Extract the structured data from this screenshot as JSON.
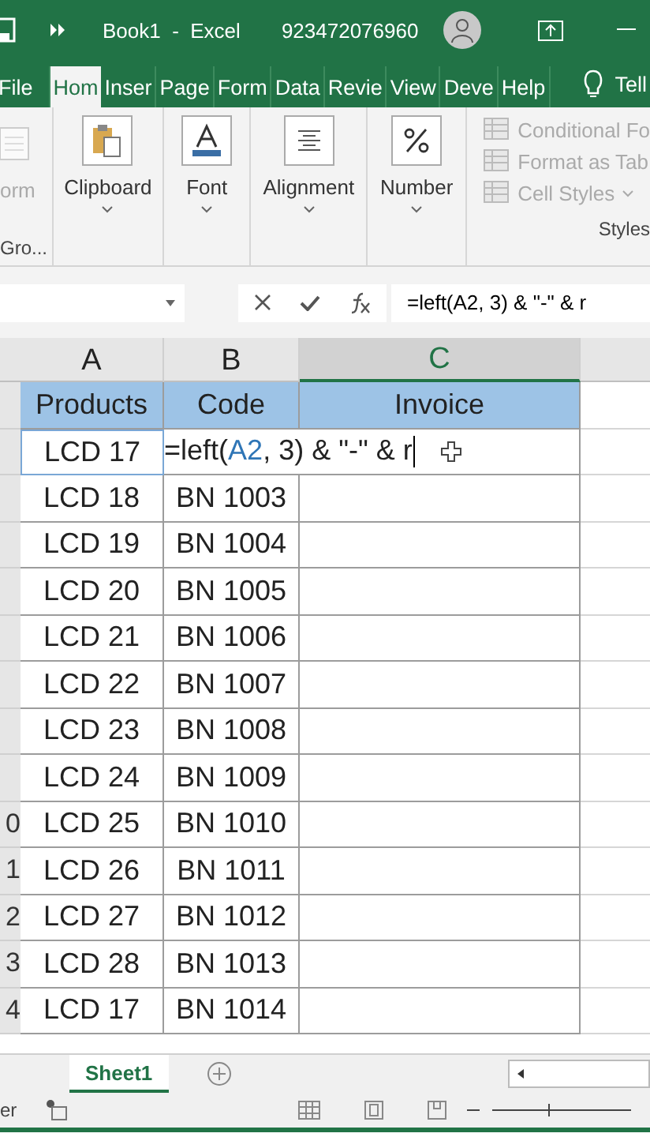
{
  "title_bar": {
    "title": "Book1  -  Excel",
    "account": "923472076960"
  },
  "ribbon_tabs": [
    {
      "label": "File",
      "selected": false
    },
    {
      "label": "Hom",
      "selected": true
    },
    {
      "label": "Inser",
      "selected": false
    },
    {
      "label": "Page",
      "selected": false
    },
    {
      "label": "Form",
      "selected": false
    },
    {
      "label": "Data",
      "selected": false
    },
    {
      "label": "Revie",
      "selected": false
    },
    {
      "label": "View",
      "selected": false
    },
    {
      "label": "Deve",
      "selected": false
    },
    {
      "label": "Help",
      "selected": false
    }
  ],
  "tell_me": "Tell",
  "ribbon_groups": [
    {
      "kind": "partial",
      "button": "orm",
      "label": "Gro..."
    },
    {
      "kind": "clipboard",
      "button": "Clipboard"
    },
    {
      "kind": "font",
      "button": "Font"
    },
    {
      "kind": "alignment",
      "button": "Alignment"
    },
    {
      "kind": "number",
      "button": "Number"
    },
    {
      "kind": "styles",
      "items": [
        "Conditional Fo",
        "Format as Tab",
        "Cell Styles"
      ],
      "label": "Styles"
    }
  ],
  "formula_bar": {
    "formula": "=left(A2, 3) & \"-\" & r"
  },
  "columns": [
    {
      "letter": "A",
      "selected": false
    },
    {
      "letter": "B",
      "selected": false
    },
    {
      "letter": "C",
      "selected": true
    }
  ],
  "header_row": [
    "Products",
    "Code",
    "Invoice"
  ],
  "rows": [
    {
      "kind": "editing",
      "product": "LCD 17",
      "formula": {
        "before": "=left(",
        "ref": "A2",
        "after": ", 3) & \"-\" & r"
      }
    },
    {
      "kind": "plain",
      "product": "LCD 18",
      "code": "BN 1003"
    },
    {
      "kind": "plain",
      "product": "LCD 19",
      "code": "BN 1004"
    },
    {
      "kind": "plain",
      "product": "LCD 20",
      "code": "BN 1005"
    },
    {
      "kind": "plain",
      "product": "LCD 21",
      "code": "BN 1006"
    },
    {
      "kind": "plain",
      "product": "LCD 22",
      "code": "BN 1007"
    },
    {
      "kind": "plain",
      "product": "LCD 23",
      "code": "BN 1008"
    },
    {
      "kind": "plain",
      "product": "LCD 24",
      "code": "BN 1009"
    },
    {
      "kind": "plain",
      "row_label": "0",
      "product": "LCD 25",
      "code": "BN 1010"
    },
    {
      "kind": "plain",
      "row_label": "1",
      "product": "LCD 26",
      "code": "BN 1011"
    },
    {
      "kind": "plain",
      "row_label": "2",
      "product": "LCD 27",
      "code": "BN 1012"
    },
    {
      "kind": "plain",
      "row_label": "3",
      "product": "LCD 28",
      "code": "BN 1013"
    },
    {
      "kind": "plain",
      "row_label": "4",
      "product": "LCD 17",
      "code": "BN 1014"
    }
  ],
  "sheet_tabs": [
    {
      "label": "Sheet1",
      "selected": true
    }
  ],
  "status_bar": {
    "text": "er"
  }
}
